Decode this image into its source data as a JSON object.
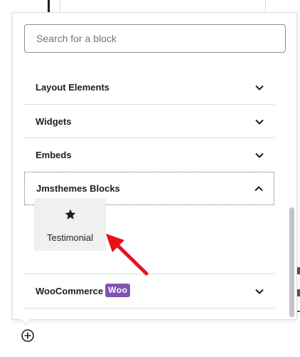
{
  "search": {
    "placeholder": "Search for a block",
    "value": ""
  },
  "categories": [
    {
      "label": "Layout Elements",
      "state": "collapsed"
    },
    {
      "label": "Widgets",
      "state": "collapsed"
    },
    {
      "label": "Embeds",
      "state": "collapsed"
    },
    {
      "label": "Jmsthemes Blocks",
      "state": "expanded"
    },
    {
      "label": "WooCommerce",
      "state": "collapsed",
      "badge": "Woo"
    }
  ],
  "blocks": [
    {
      "label": "Testimonial",
      "icon": "star-icon"
    }
  ],
  "icons": {
    "chevron_collapsed": "chevron-down-icon",
    "chevron_expanded": "chevron-up-icon",
    "inserter": "plus-circle-icon",
    "annotation": "red-arrow-icon"
  },
  "colors": {
    "annotation_arrow": "#e8111c",
    "woo_badge": "#7f54b3",
    "tile_background": "#f0f0f1",
    "text": "#1e1e1e"
  }
}
